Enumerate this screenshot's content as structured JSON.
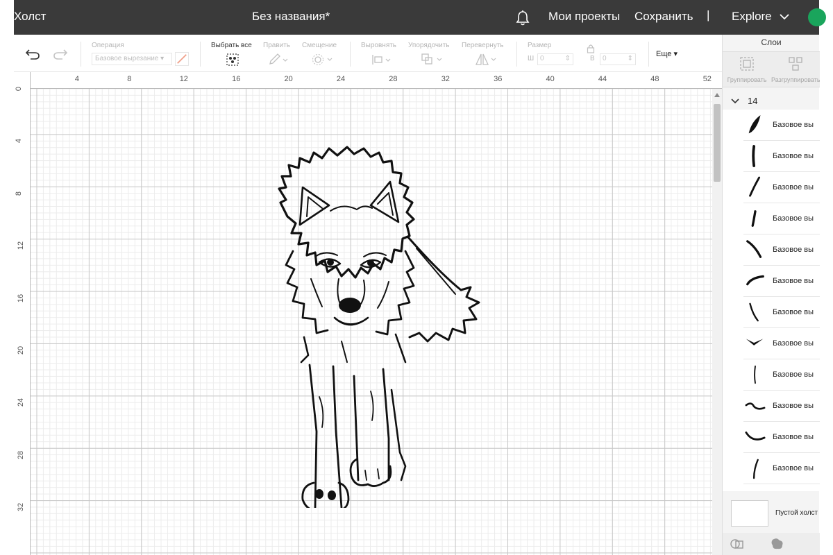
{
  "topbar": {
    "app_title": "Холст",
    "doc_title": "Без названия*",
    "my_projects": "Мои проекты",
    "save": "Сохранить",
    "separator": "|",
    "explore": "Explore"
  },
  "toolbar": {
    "operation_label": "Операция",
    "operation_value": "Базовое вырезание",
    "select_all": "Выбрать все",
    "edit": "Править",
    "offset": "Смещение",
    "align": "Выровнять",
    "arrange": "Упорядочить",
    "flip": "Перевернуть",
    "size": "Размер",
    "width_letter": "Ш",
    "height_letter": "В",
    "width_value": "0",
    "height_value": "0",
    "more": "Еще"
  },
  "rulers": {
    "horizontal": [
      "4",
      "8",
      "12",
      "16",
      "20",
      "24",
      "28",
      "32",
      "36",
      "40",
      "44",
      "48",
      "52"
    ],
    "vertical": [
      "0",
      "4",
      "8",
      "12",
      "16",
      "20",
      "24",
      "28",
      "32"
    ]
  },
  "panel": {
    "title": "Слои",
    "group_btn": "Группировать",
    "ungroup_btn": "Разгруппировать",
    "group_name": "14",
    "layer_label": "Базовое вы",
    "blank_canvas": "Пустой холст"
  },
  "colors": {
    "topbar_bg": "#3a3a3a",
    "accent_green": "#1aa55c",
    "operation_color_swatch": "#f0a08a"
  }
}
